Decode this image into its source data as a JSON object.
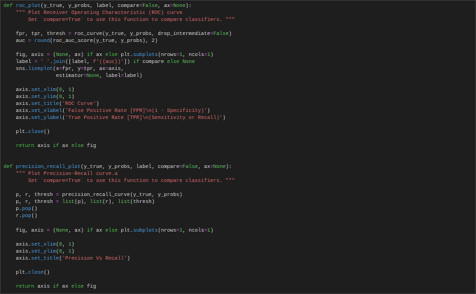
{
  "colors": {
    "background": "#1e1e1e",
    "keyword": "#4ec24e",
    "function": "#4aa0e6",
    "string": "#e06a6a",
    "operator": "#c14fd6",
    "constant": "#5fc85f",
    "text": "#d8d8d8"
  },
  "code_lines": [
    [
      [
        "k",
        "def"
      ],
      [
        "t",
        " "
      ],
      [
        "f",
        "roc_plot"
      ],
      [
        "t",
        "(y_true, y_probs, label, compare"
      ],
      [
        "o",
        "="
      ],
      [
        "n",
        "False"
      ],
      [
        "t",
        ", ax"
      ],
      [
        "o",
        "="
      ],
      [
        "n",
        "None"
      ],
      [
        "t",
        "):"
      ]
    ],
    [
      [
        "t",
        "    "
      ],
      [
        "s",
        "\"\"\" Plot Receiver Operating Characteristic (ROC) curve"
      ]
    ],
    [
      [
        "s",
        "        Set `compare=True` to use this function to compare classifiers. \"\"\""
      ]
    ],
    [],
    [
      [
        "t",
        "    fpr, tpr, thresh "
      ],
      [
        "o",
        "="
      ],
      [
        "t",
        " roc_curve(y_true, y_probs, drop_intermediate"
      ],
      [
        "o",
        "="
      ],
      [
        "n",
        "False"
      ],
      [
        "t",
        ")"
      ]
    ],
    [
      [
        "t",
        "    auc "
      ],
      [
        "o",
        "="
      ],
      [
        "t",
        " "
      ],
      [
        "f",
        "round"
      ],
      [
        "t",
        "(roc_auc_score(y_true, y_probs), 2)"
      ]
    ],
    [],
    [
      [
        "t",
        "    fig, axis "
      ],
      [
        "o",
        "="
      ],
      [
        "t",
        " ("
      ],
      [
        "n",
        "None"
      ],
      [
        "t",
        ", ax) "
      ],
      [
        "k",
        "if"
      ],
      [
        "t",
        " ax "
      ],
      [
        "k",
        "else"
      ],
      [
        "t",
        " plt."
      ],
      [
        "f",
        "subplots"
      ],
      [
        "t",
        "(nrows"
      ],
      [
        "o",
        "="
      ],
      [
        "n",
        "1"
      ],
      [
        "t",
        ", ncols"
      ],
      [
        "o",
        "="
      ],
      [
        "n",
        "1"
      ],
      [
        "t",
        ")"
      ]
    ],
    [
      [
        "t",
        "    label "
      ],
      [
        "o",
        "="
      ],
      [
        "t",
        " "
      ],
      [
        "s",
        "' '"
      ],
      [
        "t",
        "."
      ],
      [
        "f",
        "join"
      ],
      [
        "t",
        "([label, "
      ],
      [
        "s",
        "f'({auc})'"
      ],
      [
        "t",
        "]) "
      ],
      [
        "k",
        "if"
      ],
      [
        "t",
        " compare "
      ],
      [
        "k",
        "else"
      ],
      [
        "t",
        " "
      ],
      [
        "n",
        "None"
      ]
    ],
    [
      [
        "t",
        "    sns."
      ],
      [
        "f",
        "lineplot"
      ],
      [
        "t",
        "(x"
      ],
      [
        "o",
        "="
      ],
      [
        "t",
        "fpr, y"
      ],
      [
        "o",
        "="
      ],
      [
        "t",
        "tpr, ax"
      ],
      [
        "o",
        "="
      ],
      [
        "t",
        "axis,"
      ]
    ],
    [
      [
        "t",
        "                 estimator"
      ],
      [
        "o",
        "="
      ],
      [
        "n",
        "None"
      ],
      [
        "t",
        ", label"
      ],
      [
        "o",
        "="
      ],
      [
        "t",
        "label)"
      ]
    ],
    [],
    [
      [
        "t",
        "    axis."
      ],
      [
        "f",
        "set_xlim"
      ],
      [
        "t",
        "("
      ],
      [
        "n",
        "0"
      ],
      [
        "t",
        ", "
      ],
      [
        "n",
        "1"
      ],
      [
        "t",
        ")"
      ]
    ],
    [
      [
        "t",
        "    axis."
      ],
      [
        "f",
        "set_ylim"
      ],
      [
        "t",
        "("
      ],
      [
        "n",
        "0"
      ],
      [
        "t",
        ", "
      ],
      [
        "n",
        "1"
      ],
      [
        "t",
        ")"
      ]
    ],
    [
      [
        "t",
        "    axis."
      ],
      [
        "f",
        "set_title"
      ],
      [
        "t",
        "("
      ],
      [
        "s",
        "'ROC Curve'"
      ],
      [
        "t",
        ")"
      ]
    ],
    [
      [
        "t",
        "    axis."
      ],
      [
        "f",
        "set_xlabel"
      ],
      [
        "t",
        "("
      ],
      [
        "s",
        "'False Positive Rate [FPR]\\n(1 - Specificity)'"
      ],
      [
        "t",
        ")"
      ]
    ],
    [
      [
        "t",
        "    axis."
      ],
      [
        "f",
        "set_ylabel"
      ],
      [
        "t",
        "("
      ],
      [
        "s",
        "'True Positive Rate [TPR]\\n(Sensitivity or Recall)'"
      ],
      [
        "t",
        ")"
      ]
    ],
    [],
    [
      [
        "t",
        "    plt."
      ],
      [
        "f",
        "close"
      ],
      [
        "t",
        "()"
      ]
    ],
    [],
    [
      [
        "t",
        "    "
      ],
      [
        "k",
        "return"
      ],
      [
        "t",
        " axis "
      ],
      [
        "k",
        "if"
      ],
      [
        "t",
        " ax "
      ],
      [
        "k",
        "else"
      ],
      [
        "t",
        " fig"
      ]
    ],
    [],
    [],
    [
      [
        "k",
        "def"
      ],
      [
        "t",
        " "
      ],
      [
        "f",
        "precision_recall_plot"
      ],
      [
        "t",
        "(y_true, y_probs, label, compare"
      ],
      [
        "o",
        "="
      ],
      [
        "n",
        "False"
      ],
      [
        "t",
        ", ax"
      ],
      [
        "o",
        "="
      ],
      [
        "n",
        "None"
      ],
      [
        "t",
        "):"
      ]
    ],
    [
      [
        "t",
        "    "
      ],
      [
        "s",
        "\"\"\" Plot Precision-Recall curve.a"
      ]
    ],
    [
      [
        "s",
        "        Set `compare=True` to use this function to compare classifiers. \"\"\""
      ]
    ],
    [],
    [
      [
        "t",
        "    p, r, thresh "
      ],
      [
        "o",
        "="
      ],
      [
        "t",
        " precision_recall_curve(y_true, y_probs)"
      ]
    ],
    [
      [
        "t",
        "    p, r, thresh "
      ],
      [
        "o",
        "="
      ],
      [
        "t",
        " "
      ],
      [
        "n",
        "list"
      ],
      [
        "t",
        "(p), "
      ],
      [
        "n",
        "list"
      ],
      [
        "t",
        "(r), "
      ],
      [
        "n",
        "list"
      ],
      [
        "t",
        "(thresh)"
      ]
    ],
    [
      [
        "t",
        "    p."
      ],
      [
        "f",
        "pop"
      ],
      [
        "t",
        "()"
      ]
    ],
    [
      [
        "t",
        "    r."
      ],
      [
        "f",
        "pop"
      ],
      [
        "t",
        "()"
      ]
    ],
    [],
    [
      [
        "t",
        "    fig, axis "
      ],
      [
        "o",
        "="
      ],
      [
        "t",
        " ("
      ],
      [
        "n",
        "None"
      ],
      [
        "t",
        ", ax) "
      ],
      [
        "k",
        "if"
      ],
      [
        "t",
        " ax "
      ],
      [
        "k",
        "else"
      ],
      [
        "t",
        " plt."
      ],
      [
        "f",
        "subplots"
      ],
      [
        "t",
        "(nrows"
      ],
      [
        "o",
        "="
      ],
      [
        "n",
        "1"
      ],
      [
        "t",
        ", ncols"
      ],
      [
        "o",
        "="
      ],
      [
        "n",
        "1"
      ],
      [
        "t",
        ")"
      ]
    ],
    [],
    [
      [
        "t",
        "    axis."
      ],
      [
        "f",
        "set_xlim"
      ],
      [
        "t",
        "("
      ],
      [
        "n",
        "0"
      ],
      [
        "t",
        ", "
      ],
      [
        "n",
        "1"
      ],
      [
        "t",
        ")"
      ]
    ],
    [
      [
        "t",
        "    axis."
      ],
      [
        "f",
        "set_ylim"
      ],
      [
        "t",
        "("
      ],
      [
        "n",
        "0"
      ],
      [
        "t",
        ", "
      ],
      [
        "n",
        "1"
      ],
      [
        "t",
        ")"
      ]
    ],
    [
      [
        "t",
        "    axis."
      ],
      [
        "f",
        "set_title"
      ],
      [
        "t",
        "("
      ],
      [
        "s",
        "'Precision Vs Recall'"
      ],
      [
        "t",
        ")"
      ]
    ],
    [],
    [
      [
        "t",
        "    plt."
      ],
      [
        "f",
        "close"
      ],
      [
        "t",
        "()"
      ]
    ],
    [],
    [
      [
        "t",
        "    "
      ],
      [
        "k",
        "return"
      ],
      [
        "t",
        " axis "
      ],
      [
        "k",
        "if"
      ],
      [
        "t",
        " ax "
      ],
      [
        "k",
        "else"
      ],
      [
        "t",
        " fig"
      ]
    ]
  ]
}
